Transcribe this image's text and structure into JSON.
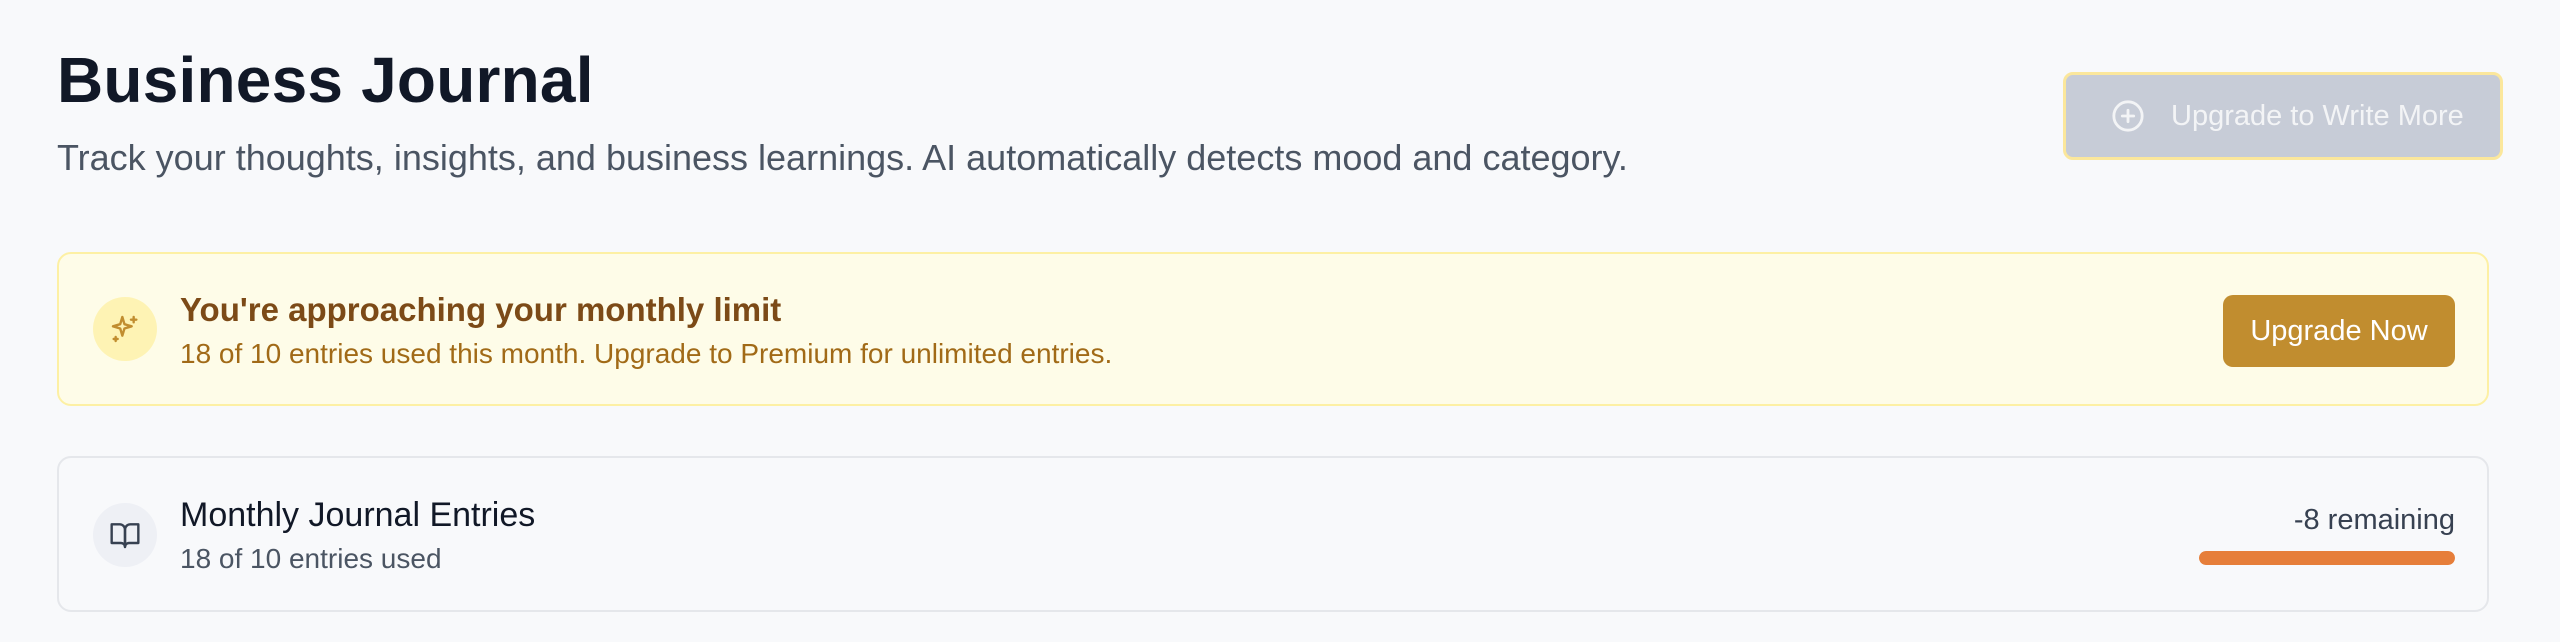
{
  "header": {
    "title": "Business Journal",
    "subtitle": "Track your thoughts, insights, and business learnings. AI automatically detects mood and category.",
    "upgrade_button_label": "Upgrade to Write More",
    "upgrade_button_icon": "plus-circle-icon"
  },
  "limit_banner": {
    "icon": "sparkles-icon",
    "title": "You're approaching your monthly limit",
    "message": "18 of 10 entries used this month. Upgrade to Premium for unlimited entries.",
    "button_label": "Upgrade Now"
  },
  "usage": {
    "icon": "book-open-icon",
    "title": "Monthly Journal Entries",
    "subtitle": "18 of 10 entries used",
    "remaining_label": "-8 remaining",
    "progress_fraction": 1.0
  },
  "colors": {
    "accent_gold": "#c18d2f",
    "progress_orange": "#e67e3a",
    "banner_bg": "#fefce8"
  }
}
